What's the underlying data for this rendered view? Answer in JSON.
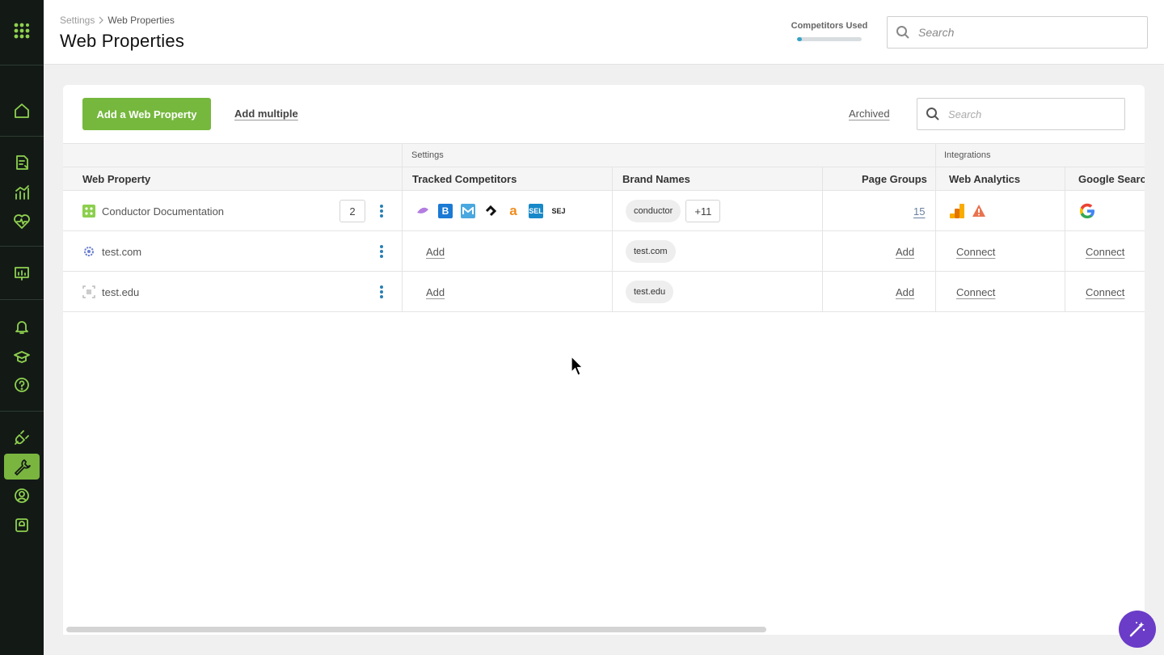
{
  "header": {
    "breadcrumb": [
      "Settings",
      "Web Properties"
    ],
    "title": "Web Properties",
    "competitors_used_label": "Competitors Used",
    "competitors_used_fraction": 0.08,
    "search_placeholder": "Search"
  },
  "toolbar": {
    "add_button": "Add a Web Property",
    "add_multiple": "Add multiple",
    "archived": "Archived",
    "search_placeholder": "Search"
  },
  "table": {
    "groups": [
      "Settings",
      "Integrations"
    ],
    "columns": [
      "Web Property",
      "Tracked Competitors",
      "Brand Names",
      "Page Groups",
      "Web Analytics",
      "Google Searc"
    ],
    "rows": [
      {
        "name": "Conductor Documentation",
        "count": "2",
        "competitors": [
          "sem",
          "B",
          "M",
          "ah",
          "a",
          "SEL",
          "SEJ"
        ],
        "brand": "conductor",
        "brand_more": "+11",
        "page_groups": "15"
      },
      {
        "name": "test.com",
        "competitors_action": "Add",
        "brand": "test.com",
        "page_groups_action": "Add",
        "web_analytics_action": "Connect",
        "google_search_action": "Connect"
      },
      {
        "name": "test.edu",
        "competitors_action": "Add",
        "brand": "test.edu",
        "page_groups_action": "Add",
        "web_analytics_action": "Connect",
        "google_search_action": "Connect"
      }
    ]
  },
  "colors": {
    "sidebar_bg": "#131a16",
    "accent_green": "#76b83e",
    "progress_blue": "#37a3c5",
    "kebab_blue": "#2b7fb5",
    "magic_purple": "#6a3cc7"
  }
}
